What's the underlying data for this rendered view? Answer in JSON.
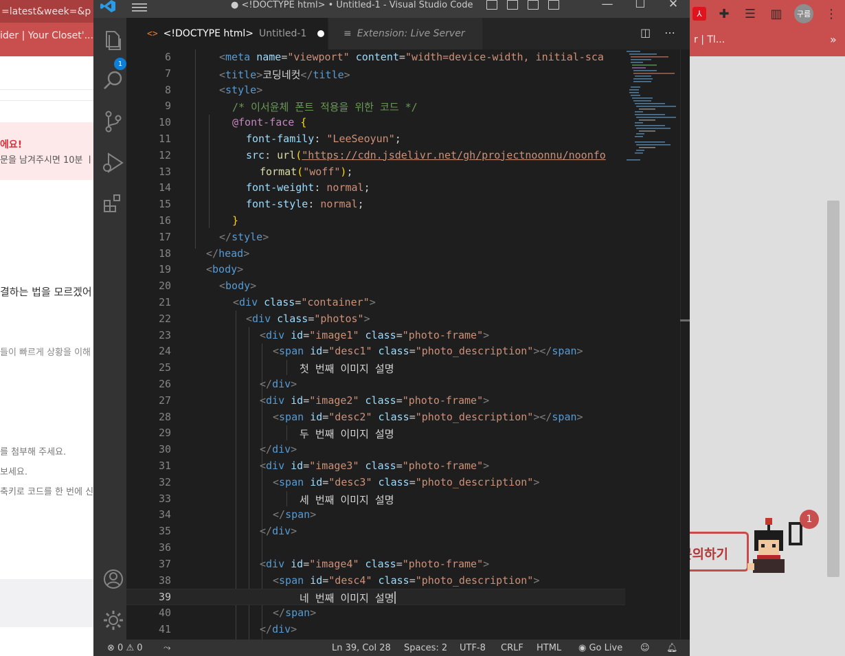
{
  "background_browser": {
    "url_fragment": "=latest&week=&p",
    "bookmark_left": "ider | Your Closet'...",
    "bookmark_right": "r | Tl...",
    "overflow_chevron": "»",
    "avatar_label": "구름",
    "alert_title": "에요!",
    "alert_body": "문을 남겨주시면 10분 ㅣ",
    "text_1": "결하는 법을 모르겠어",
    "text_2": "들이 빠르게 상황을 이해",
    "text_3": "를 첨부해 주세요.",
    "text_4": "보세요.",
    "text_5": "축키로 코드를 한 번에 신",
    "ask_button_label": "문의하기",
    "notification_count": "1"
  },
  "titlebar": {
    "title": "● <!DOCTYPE html> • Untitled-1 - Visual Studio Code"
  },
  "activity_bar": {
    "explorer_badge": "1"
  },
  "tabs": [
    {
      "icon": "<>",
      "label": "<!DOCTYPE html>",
      "sublabel": "Untitled-1",
      "dirty": true
    },
    {
      "icon": "≡",
      "label": "Extension: Live Server"
    }
  ],
  "editor": {
    "current_line": 39,
    "lines": [
      {
        "n": "6"
      },
      {
        "n": "7"
      },
      {
        "n": "8"
      },
      {
        "n": "9"
      },
      {
        "n": "10"
      },
      {
        "n": "11"
      },
      {
        "n": "12"
      },
      {
        "n": "13"
      },
      {
        "n": "14"
      },
      {
        "n": "15"
      },
      {
        "n": "16"
      },
      {
        "n": "17"
      },
      {
        "n": "18"
      },
      {
        "n": "19"
      },
      {
        "n": "20"
      },
      {
        "n": "21"
      },
      {
        "n": "22"
      },
      {
        "n": "23"
      },
      {
        "n": "24"
      },
      {
        "n": "25"
      },
      {
        "n": "26"
      },
      {
        "n": "27"
      },
      {
        "n": "28"
      },
      {
        "n": "29"
      },
      {
        "n": "30"
      },
      {
        "n": "31"
      },
      {
        "n": "32"
      },
      {
        "n": "33"
      },
      {
        "n": "34"
      },
      {
        "n": "35"
      },
      {
        "n": "36"
      },
      {
        "n": "37"
      },
      {
        "n": "38"
      },
      {
        "n": "39"
      },
      {
        "n": "40"
      },
      {
        "n": "41"
      }
    ],
    "code": {
      "meta_attr_name": "name",
      "meta_name_val": "\"viewport\"",
      "meta_attr_content": "content",
      "meta_content_val": "\"width=device-width, initial-sca",
      "title_text": "코딩네컷",
      "comment": "/* 이서윤체 폰트 적용을 위한 코드 */",
      "font_face": "@font-face",
      "font_family_prop": "font-family",
      "font_family_val": "\"LeeSeoyun\"",
      "src_prop": "src",
      "src_url": "\"https://cdn.jsdelivr.net/gh/projectnoonnu/noonfo",
      "format_val": "\"woff\"",
      "font_weight_prop": "font-weight",
      "font_weight_val": "normal",
      "font_style_prop": "font-style",
      "font_style_val": "normal",
      "class_attr": "class",
      "id_attr": "id",
      "container_val": "\"container\"",
      "photos_val": "\"photos\"",
      "frame_val": "\"photo-frame\"",
      "desc_class_val": "\"photo_description\"",
      "image1": "\"image1\"",
      "image2": "\"image2\"",
      "image3": "\"image3\"",
      "image4": "\"image4\"",
      "desc1": "\"desc1\"",
      "desc2": "\"desc2\"",
      "desc3": "\"desc3\"",
      "desc4": "\"desc4\"",
      "text1": "첫 번째 이미지 설명",
      "text2": "두 번째 이미지 설명",
      "text3": "세 번째 이미지 설명",
      "text4": "네 번째 이미지 설명"
    }
  },
  "statusbar": {
    "errors": "0",
    "warnings": "0",
    "position": "Ln 39, Col 28",
    "spaces": "Spaces: 2",
    "encoding": "UTF-8",
    "eol": "CRLF",
    "language": "HTML",
    "go_live": "Go Live"
  },
  "colors": {
    "vscode_bg": "#1e1e1e",
    "activity_bg": "#333333",
    "tab_bar_bg": "#252526",
    "titlebar_bg": "#3c3c3c",
    "statusbar_bg": "#333333",
    "badge_blue": "#0e7fd4",
    "browser_red": "#c94f4f"
  }
}
